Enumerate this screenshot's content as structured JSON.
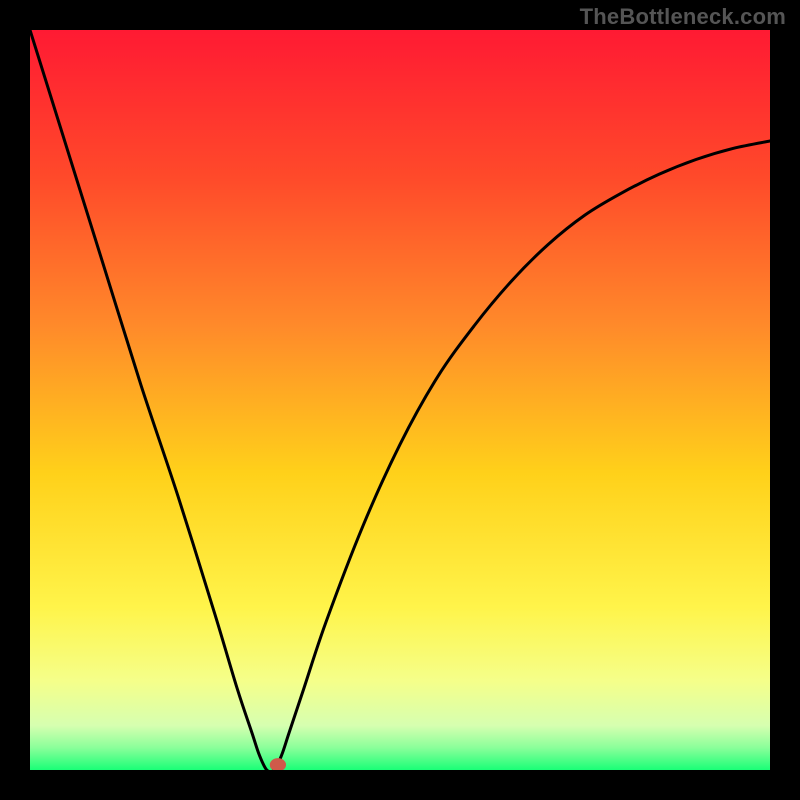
{
  "watermark": "TheBottleneck.com",
  "chart_data": {
    "type": "line",
    "title": "",
    "xlabel": "",
    "ylabel": "",
    "xlim": [
      0,
      100
    ],
    "ylim": [
      0,
      100
    ],
    "grid": false,
    "legend": false,
    "vertex": {
      "x": 32,
      "y": 0
    },
    "series": [
      {
        "name": "curve",
        "x": [
          0,
          5,
          10,
          15,
          20,
          25,
          28,
          30,
          31,
          32,
          33,
          34,
          35,
          37,
          40,
          45,
          50,
          55,
          60,
          65,
          70,
          75,
          80,
          85,
          90,
          95,
          100
        ],
        "y": [
          100,
          84,
          68,
          52,
          37,
          21,
          11,
          5,
          2,
          0,
          0,
          2,
          5,
          11,
          20,
          33,
          44,
          53,
          60,
          66,
          71,
          75,
          78,
          80.5,
          82.5,
          84,
          85
        ]
      }
    ],
    "marker": {
      "x": 33.5,
      "y": 0.7,
      "rx": 1.1,
      "ry": 0.9,
      "color": "#cf5a4a"
    },
    "gradient_stops": [
      {
        "offset": 0,
        "color": "#ff1a33"
      },
      {
        "offset": 20,
        "color": "#ff4a2a"
      },
      {
        "offset": 40,
        "color": "#ff8a2a"
      },
      {
        "offset": 60,
        "color": "#ffd11a"
      },
      {
        "offset": 78,
        "color": "#fff44a"
      },
      {
        "offset": 88,
        "color": "#f5ff8a"
      },
      {
        "offset": 94,
        "color": "#d6ffb0"
      },
      {
        "offset": 97,
        "color": "#8aff9a"
      },
      {
        "offset": 100,
        "color": "#1aff77"
      }
    ]
  }
}
